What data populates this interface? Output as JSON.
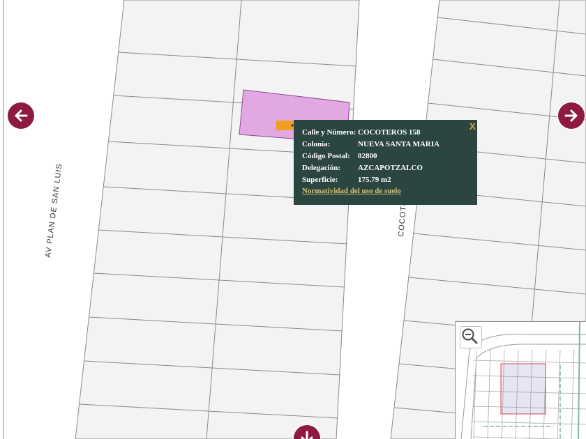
{
  "colors": {
    "nav_button": "#8e1b3f",
    "popup_bg": "#2b4540",
    "popup_link": "#d9c07a",
    "close_x": "#d9a43b",
    "selected_parcel": "#e2a8e4",
    "marker": "#f0a020",
    "overview_frame": "#e06060"
  },
  "map": {
    "streets": {
      "av_plan_de_san_luis": "AV PLAN DE SAN LUIS",
      "cocoteros": "COCOTEROS"
    }
  },
  "nav": {
    "left_icon": "arrow-left-icon",
    "right_icon": "arrow-right-icon",
    "down_icon": "arrow-down-icon"
  },
  "popup": {
    "close": "X",
    "rows": [
      {
        "label": "Calle y Número:",
        "value": "COCOTEROS 158"
      },
      {
        "label": "Colonia:",
        "value": "NUEVA SANTA MARIA"
      },
      {
        "label": "Código Postal:",
        "value": "02800"
      },
      {
        "label": "Delegación:",
        "value": "AZCAPOTZALCO"
      },
      {
        "label": "Superficie:",
        "value": "175.79 m2"
      }
    ],
    "link": "Normatividad del uso de suelo"
  },
  "overview": {
    "zoom_icon": "zoom-out-icon"
  }
}
